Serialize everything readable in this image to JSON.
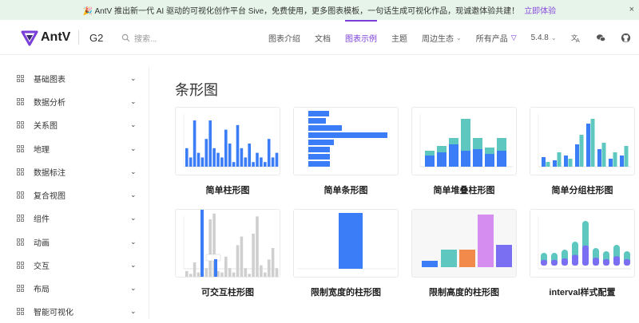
{
  "banner": {
    "text": "🎉 AntV 推出新一代 AI 驱动的可视化创作平台 Sive，免费使用，更多图表模板，一句话生成可视化作品，现诚邀体验共建！",
    "link": "立即体验",
    "close": "×"
  },
  "header": {
    "logo_text": "AntV",
    "product": "G2",
    "search_placeholder": "搜索...",
    "nav": [
      {
        "label": "图表介绍"
      },
      {
        "label": "文档"
      },
      {
        "label": "图表示例",
        "active": true
      },
      {
        "label": "主题"
      },
      {
        "label": "周边生态",
        "caret": "⌄"
      },
      {
        "label": "所有产品",
        "extra": "▽"
      },
      {
        "label": "5.4.8",
        "caret": "⌄"
      }
    ]
  },
  "sidebar": {
    "items": [
      {
        "label": "基础图表"
      },
      {
        "label": "数据分析"
      },
      {
        "label": "关系图"
      },
      {
        "label": "地理"
      },
      {
        "label": "数据标注"
      },
      {
        "label": "复合视图"
      },
      {
        "label": "组件"
      },
      {
        "label": "动画"
      },
      {
        "label": "交互"
      },
      {
        "label": "布局"
      },
      {
        "label": "智能可视化"
      }
    ],
    "chevron": "⌄"
  },
  "main": {
    "title": "条形图",
    "cards": [
      {
        "caption": "简单柱形图",
        "thumb": "simple-column"
      },
      {
        "caption": "简单条形图",
        "thumb": "simple-bar"
      },
      {
        "caption": "简单堆叠柱形图",
        "thumb": "stacked-column"
      },
      {
        "caption": "简单分组柱形图",
        "thumb": "grouped-column"
      },
      {
        "caption": "可交互柱形图",
        "thumb": "interactive-column"
      },
      {
        "caption": "限制宽度的柱形图",
        "thumb": "max-width-column"
      },
      {
        "caption": "限制高度的柱形图",
        "thumb": "max-height-column"
      },
      {
        "caption": "interval样式配置",
        "thumb": "interval-style"
      }
    ]
  },
  "colors": {
    "accent": "#7a3fd8",
    "bar_blue": "#3b7df6",
    "teal": "#5ec8c0",
    "orange": "#f28a4c",
    "pink": "#d58ef0",
    "purple": "#7a6ff2"
  }
}
